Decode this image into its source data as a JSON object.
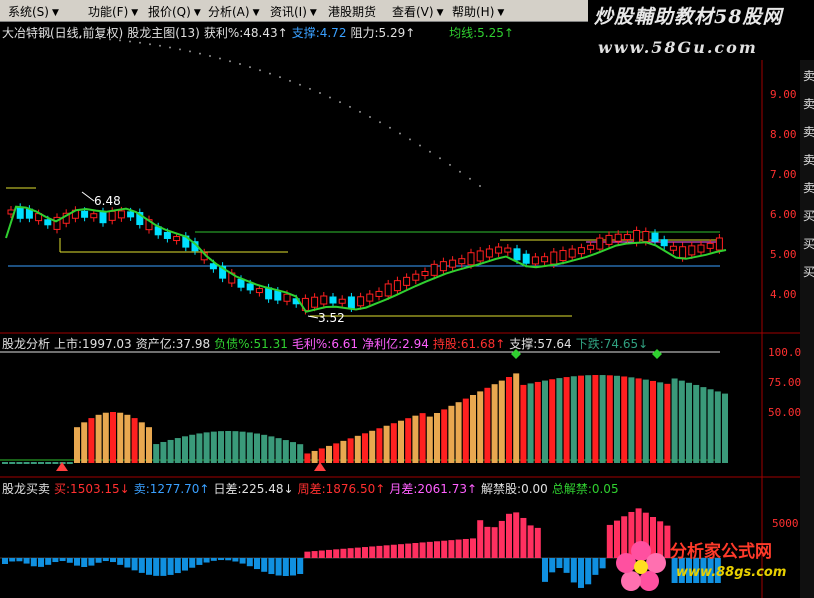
{
  "menu": [
    {
      "label": "系统(S)"
    },
    {
      "label": "功能(F)"
    },
    {
      "label": "报价(Q)"
    },
    {
      "label": "分析(A)"
    },
    {
      "label": "资讯(I)"
    },
    {
      "label": "港股期货"
    },
    {
      "label": "查看(V)"
    },
    {
      "label": "帮助(H)"
    }
  ],
  "brand": {
    "title": "炒股輔助教材58股网",
    "url": "www.58Gu.com"
  },
  "main_panel": {
    "title": "大冶特钢(日线,前复权)",
    "indicator": "股龙主图(13)",
    "profit": "获利%:48.43↑",
    "support": "支撑:4.72",
    "resistance": "阻力:5.29↑",
    "avg": "均线:5.25↑",
    "y_ticks": [
      "9.00",
      "8.00",
      "7.00",
      "6.00",
      "5.00",
      "4.00"
    ],
    "high_mark": "6.48",
    "low_mark": "3.52"
  },
  "mid_panel": {
    "title": "股龙分析",
    "listed": "上市:1997.03",
    "assets": "资产亿:37.98",
    "debt": "负债%:51.31",
    "margin": "毛利%:6.61",
    "net": "净利亿:2.94",
    "hold": "持股:61.68↑",
    "support": "支撑:57.64",
    "fall": "下跌:74.65↓",
    "y_ticks": [
      "100.0",
      "75.00",
      "50.00"
    ]
  },
  "low_panel": {
    "title": "股龙买卖",
    "buy": "买:1503.15↓",
    "sell": "卖:1277.70↑",
    "day_diff": "日差:225.48↓",
    "week_diff": "周差:1876.50↑",
    "month_diff": "月差:2061.73↑",
    "unlock": "解禁股:0.00",
    "total_unlock": "总解禁:0.05",
    "y_ticks": [
      "5000"
    ]
  },
  "right_strip": [
    "卖",
    "卖",
    "卖",
    "卖",
    "卖",
    "买",
    "买",
    "买"
  ],
  "watermark": {
    "title": "分析家公式网",
    "url": "www.88gs.com"
  },
  "colors": {
    "up": "#ff2020",
    "down": "#00e0ff",
    "ma": "#30d030",
    "bg": "#000000"
  }
}
